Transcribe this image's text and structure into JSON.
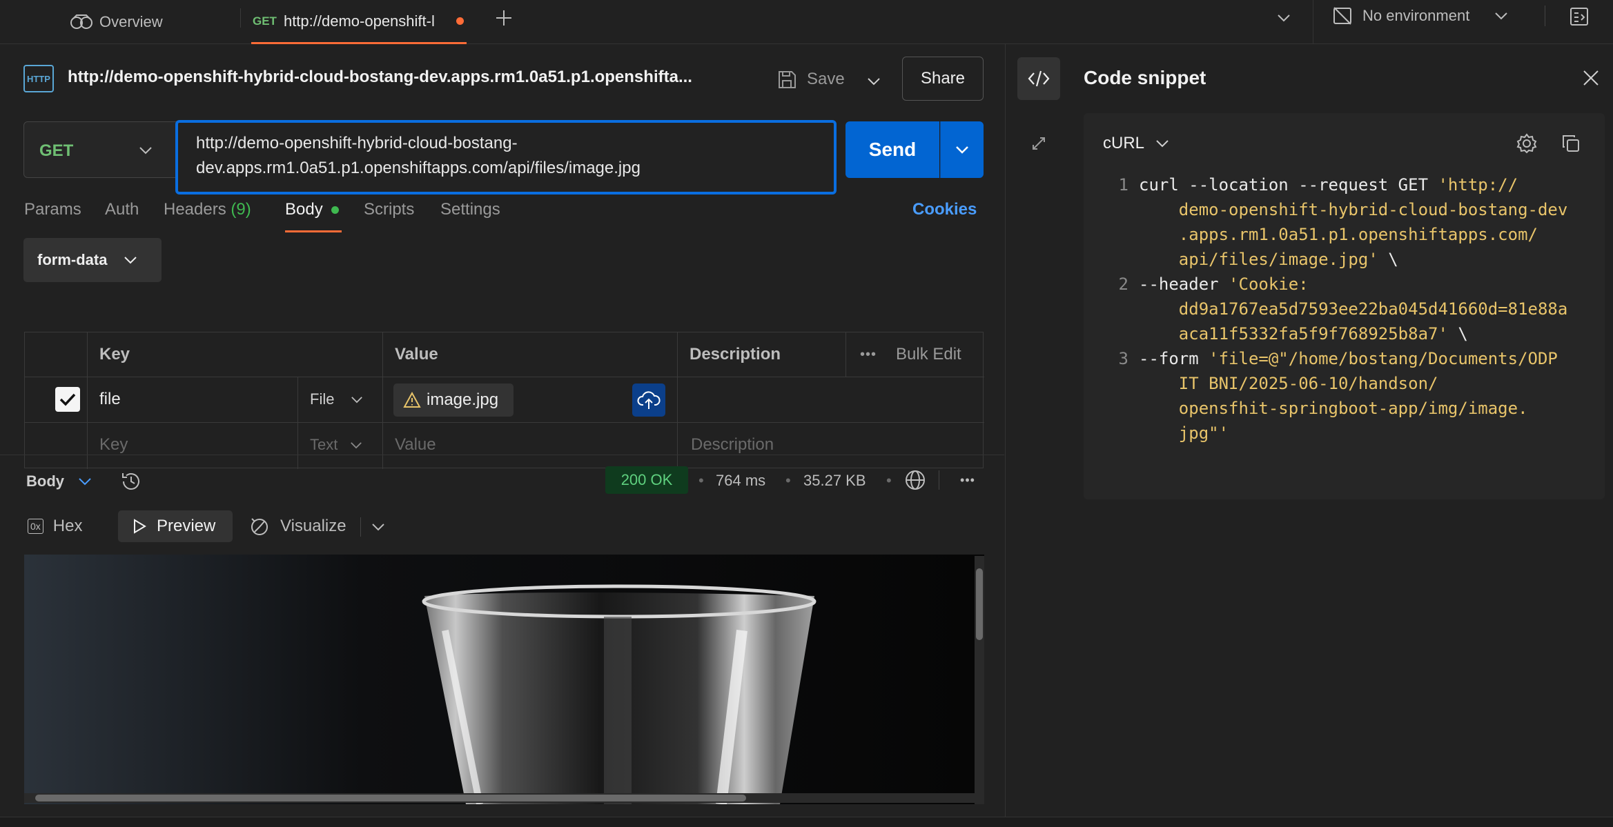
{
  "tabs": {
    "overview": "Overview",
    "active_method": "GET",
    "active_url": "http://demo-openshift-l",
    "environment": "No environment"
  },
  "request": {
    "badge": "HTTP",
    "title": "http://demo-openshift-hybrid-cloud-bostang-dev.apps.rm1.0a51.p1.openshifta...",
    "save": "Save",
    "share": "Share",
    "method": "GET",
    "url_line1": "http://demo-openshift-hybrid-cloud-bostang-",
    "url_line2": "dev.apps.rm1.0a51.p1.openshiftapps.com/api/files/image.jpg",
    "send": "Send"
  },
  "subtabs": {
    "params": "Params",
    "auth": "Auth",
    "headers": "Headers",
    "headers_count": "(9)",
    "body": "Body",
    "scripts": "Scripts",
    "settings": "Settings",
    "cookies": "Cookies"
  },
  "body_mode": "form-data",
  "table": {
    "headers": {
      "key": "Key",
      "value": "Value",
      "description": "Description",
      "bulk_edit": "Bulk Edit"
    },
    "row1": {
      "key": "file",
      "type": "File",
      "value": "image.jpg"
    },
    "row2": {
      "key_placeholder": "Key",
      "type": "Text",
      "value_placeholder": "Value",
      "description_placeholder": "Description"
    }
  },
  "response": {
    "label": "Body",
    "status": "200 OK",
    "time": "764 ms",
    "size": "35.27 KB",
    "hex": "Hex",
    "preview": "Preview",
    "visualize": "Visualize"
  },
  "snippet": {
    "title": "Code snippet",
    "language": "cURL",
    "lines": [
      {
        "num": "1",
        "text": "curl --location --request GET ",
        "str": "'http://"
      },
      {
        "num": "",
        "text": "    ",
        "str": "demo-openshift-hybrid-cloud-bostang-dev"
      },
      {
        "num": "",
        "text": "    ",
        "str": ".apps.rm1.0a51.p1.openshiftapps.com/"
      },
      {
        "num": "",
        "text": "    ",
        "str": "api/files/image.jpg'",
        "tail": " \\"
      },
      {
        "num": "2",
        "text": "--header ",
        "str": "'Cookie:"
      },
      {
        "num": "",
        "text": "    ",
        "str": "dd9a1767ea5d7593ee22ba045d41660d=81e88a"
      },
      {
        "num": "",
        "text": "    ",
        "str": "aca11f5332fa5f9f768925b8a7'",
        "tail": " \\"
      },
      {
        "num": "3",
        "text": "--form ",
        "str": "'file=@\"/home/bostang/Documents/ODP"
      },
      {
        "num": "",
        "text": "    ",
        "str": "IT BNI/2025-06-10/handson/"
      },
      {
        "num": "",
        "text": "    ",
        "str": "opensfhit-springboot-app/img/image."
      },
      {
        "num": "",
        "text": "    ",
        "str": "jpg\"'"
      }
    ]
  },
  "colors": {
    "accent": "#0265d2",
    "orange": "#ff6c37",
    "green": "#3fb950",
    "link": "#4a9dff",
    "string": "#e8c46a"
  }
}
